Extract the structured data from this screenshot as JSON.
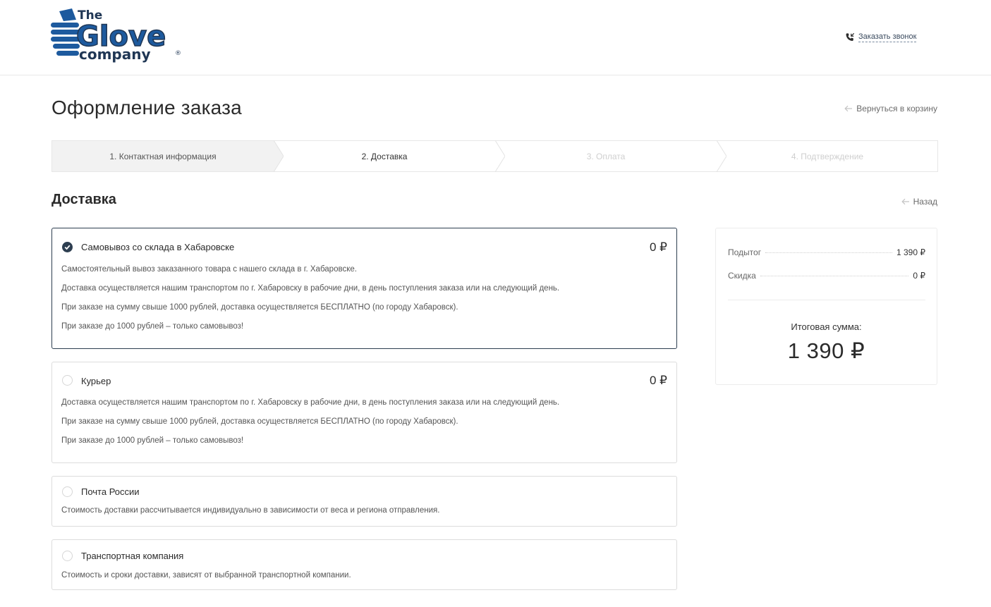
{
  "header": {
    "logo": {
      "line1": "The",
      "line2": "Glove",
      "line3": "company",
      "mark": "®"
    },
    "callback_label": "Заказать звонок",
    "callback_icon": "phone-incoming-icon"
  },
  "page": {
    "title": "Оформление заказа",
    "back_to_cart": "Вернуться в корзину"
  },
  "steps": [
    {
      "label": "1. Контактная информация",
      "state": "done"
    },
    {
      "label": "2. Доставка",
      "state": "active"
    },
    {
      "label": "3. Оплата",
      "state": "pending"
    },
    {
      "label": "4. Подтверждение",
      "state": "pending"
    }
  ],
  "delivery": {
    "title": "Доставка",
    "back": "Назад",
    "options": [
      {
        "name": "Самовывоз со склада в Хабаровске",
        "price": "0 ₽",
        "selected": true,
        "lines": [
          "Самостоятельный вывоз заказанного товара с нашего склада в г. Хабаровске.",
          "Доставка осуществляется нашим транспортом по г. Хабаровску в рабочие дни, в день поступления заказа или на следующий день.",
          "При заказе на сумму свыше 1000 рублей, доставка осуществляется БЕСПЛАТНО (по городу Хабаровск).",
          "При заказе до 1000 рублей – только самовывоз!"
        ]
      },
      {
        "name": "Курьер",
        "price": "0 ₽",
        "selected": false,
        "lines": [
          "Доставка осуществляется нашим транспортом по г. Хабаровску в рабочие дни, в день поступления заказа или на следующий день.",
          "При заказе на сумму свыше 1000 рублей, доставка осуществляется БЕСПЛАТНО (по городу Хабаровск).",
          "При заказе до 1000 рублей – только самовывоз!"
        ]
      },
      {
        "name": "Почта России",
        "selected": false,
        "lines": [
          "Стоимость доставки рассчитывается индивидуально в зависимости от веса и региона отправления."
        ]
      },
      {
        "name": "Транспортная компания",
        "selected": false,
        "lines": [
          "Стоимость и сроки доставки, зависят от выбранной транспортной компании."
        ]
      }
    ]
  },
  "summary": {
    "subtotal_label": "Подытог",
    "subtotal_value": "1 390 ₽",
    "discount_label": "Скидка",
    "discount_value": "0 ₽",
    "total_label": "Итоговая сумма:",
    "total_value": "1 390 ₽"
  },
  "colors": {
    "brand_blue": "#1d5a9e",
    "brand_dark": "#1f3654",
    "accent": "#2d3e50"
  }
}
